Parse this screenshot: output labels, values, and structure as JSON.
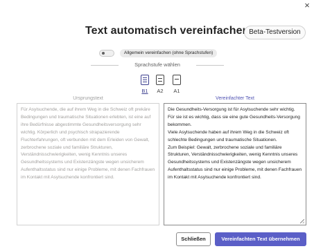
{
  "dialog": {
    "close_glyph": "×",
    "title": "Text automatisch vereinfachen",
    "beta_badge": "Beta-Testversion"
  },
  "toggle": {
    "label": "Allgemein vereinfachen (ohne Sprachstufen)",
    "state": "off"
  },
  "language_level": {
    "heading": "Sprachstufe wählen",
    "options": [
      {
        "label": "B1",
        "icon": "document-icon",
        "selected": true
      },
      {
        "label": "A2",
        "icon": "document-icon",
        "selected": false
      },
      {
        "label": "A1",
        "icon": "document-icon",
        "selected": false
      }
    ]
  },
  "original": {
    "heading": "Ursprungstext",
    "text": "Für Asylsuchende, die auf ihrem Weg in die Schweiz oft prekäre Bedingungen und traumatische Situationen erlebten, ist eine auf ihre Bedürfnisse abgestimmte Gesundheitsversorgung sehr wichtig. Körperlich und psychisch strapazierende Fluchterfahrungen, oft verbunden mit dem Erleiden von Gewalt, zerbrochene soziale und familiäre Strukturen, Verständnisschwierigkeiten, wenig Kenntnis unseres Gesundheitssystems und Existenzängste wegen unsicherem Aufenthaltsstatus sind nur einige Probleme, mit denen Fachfrauen im Kontakt mit Asylsuchende konfrontiert sind."
  },
  "simplified": {
    "heading": "Vereinfachter Text",
    "text": "Die Gesundheits-Versorgung ist für Asylsuchende sehr wichtig.\nFür sie ist es wichtig, dass sie eine gute Gesundheits-Versorgung bekommen.\nViele Asylsuchende haben auf ihrem Weg in die Schweiz oft schlechte Bedingungen und traumatische Situationen.\nZum Beispiel: Gewalt, zerbrochene soziale und familiäre Strukturen, Verständnisschwierigkeiten, wenig Kenntnis unseres Gesundheitssystems und Existenzängste wegen unsicherem Aufenthaltsstatus sind nur einige Probleme, mit denen Fachfrauen im Kontakt mit Asylsuchende konfrontiert sind."
  },
  "buttons": {
    "close": "Schließen",
    "apply": "Vereinfachten Text übernehmen"
  },
  "colors": {
    "accent": "#5b5fc7",
    "accent_text": "#4f52b2",
    "selected_level": "#3c3f8f"
  }
}
